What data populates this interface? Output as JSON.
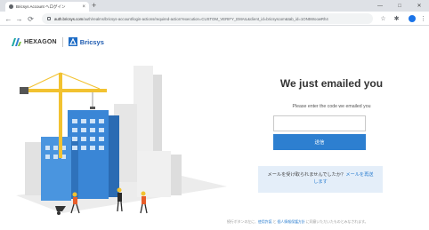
{
  "browser": {
    "tab_title": "Bricsys Account へログイン",
    "tab_close": "×",
    "new_tab": "+",
    "window_controls": [
      "—",
      "□",
      "✕"
    ],
    "url_host": "auth.bricsys.com",
    "url_rest": "/auth/realms/bricsys-account/login-actions/required-action?execution=CUSTOM_VERIFY_EMAIL&client_id=bricsyscom&tab_id=1ON5WoowRh4",
    "icons": [
      "back-icon",
      "forward-icon",
      "reload-icon",
      "lock-icon",
      "star-icon",
      "extension-icon",
      "menu-icon"
    ]
  },
  "brand": {
    "hexagon": "HEXAGON",
    "bricsys": "Bricsys"
  },
  "main": {
    "heading": "We just emailed you",
    "subtitle": "Please enter the code we emailed you",
    "code_value": "",
    "send_label": "送信"
  },
  "notice": {
    "text": "メールを受け取られませんでしたか？",
    "link": "メールを再送します"
  },
  "footer": {
    "before": "続行ボタンの左に、",
    "terms": "使用許諾",
    "mid": " と ",
    "privacy": "個人情報保護方針",
    "after": " に同意いただいたものとみなされます。"
  },
  "colors": {
    "accent": "#2d7fd0",
    "notice_bg": "#e4eef9",
    "building_blue": "#3a86d6",
    "crane_yellow": "#f2c230"
  }
}
